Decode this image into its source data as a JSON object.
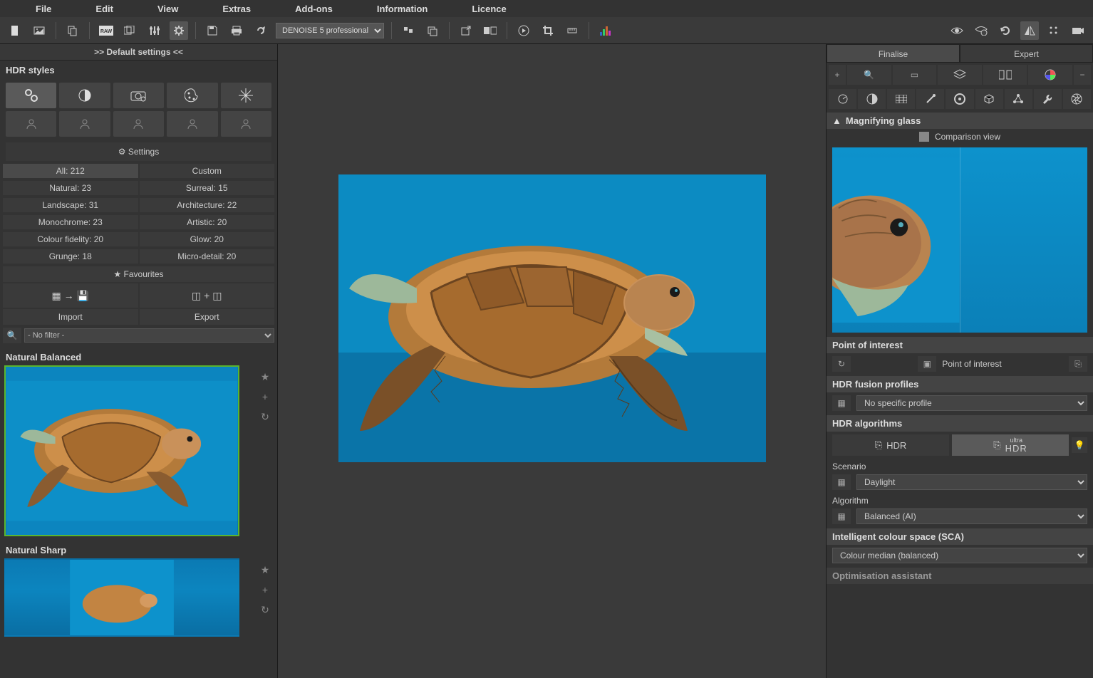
{
  "menu": {
    "items": [
      "File",
      "Edit",
      "View",
      "Extras",
      "Add-ons",
      "Information",
      "Licence"
    ]
  },
  "toolbar": {
    "plugin_select": "DENOISE 5 professional"
  },
  "left": {
    "default_label": ">> Default settings <<",
    "hdr_styles_label": "HDR styles",
    "settings_label": "Settings",
    "categories": {
      "all": "All: 212",
      "custom": "Custom",
      "natural": "Natural: 23",
      "surreal": "Surreal: 15",
      "landscape": "Landscape: 31",
      "architecture": "Architecture: 22",
      "monochrome": "Monochrome: 23",
      "artistic": "Artistic: 20",
      "colour_fidelity": "Colour fidelity: 20",
      "glow": "Glow: 20",
      "grunge": "Grunge: 18",
      "micro_detail": "Micro-detail: 20"
    },
    "favourites_label": "Favourites",
    "import_label": "Import",
    "export_label": "Export",
    "filter_placeholder": "- No filter -",
    "presets": [
      {
        "title": "Natural Balanced",
        "selected": true
      },
      {
        "title": "Natural Sharp",
        "selected": false
      }
    ]
  },
  "right": {
    "tab_finalise": "Finalise",
    "tab_expert": "Expert",
    "magnify_label": "Magnifying glass",
    "comparison_label": "Comparison view",
    "poi_label": "Point of interest",
    "poi_text": "Point of interest",
    "fusion_label": "HDR fusion profiles",
    "fusion_value": "No specific profile",
    "algo_label": "HDR algorithms",
    "hdr_btn": "HDR",
    "ultrahdr_top": "ultra",
    "ultrahdr_bot": "HDR",
    "scenario_label": "Scenario",
    "scenario_value": "Daylight",
    "algorithm_label": "Algorithm",
    "algorithm_value": "Balanced (AI)",
    "ics_label": "Intelligent colour space (SCA)",
    "ics_value": "Colour median (balanced)",
    "opt_label": "Optimisation assistant"
  }
}
